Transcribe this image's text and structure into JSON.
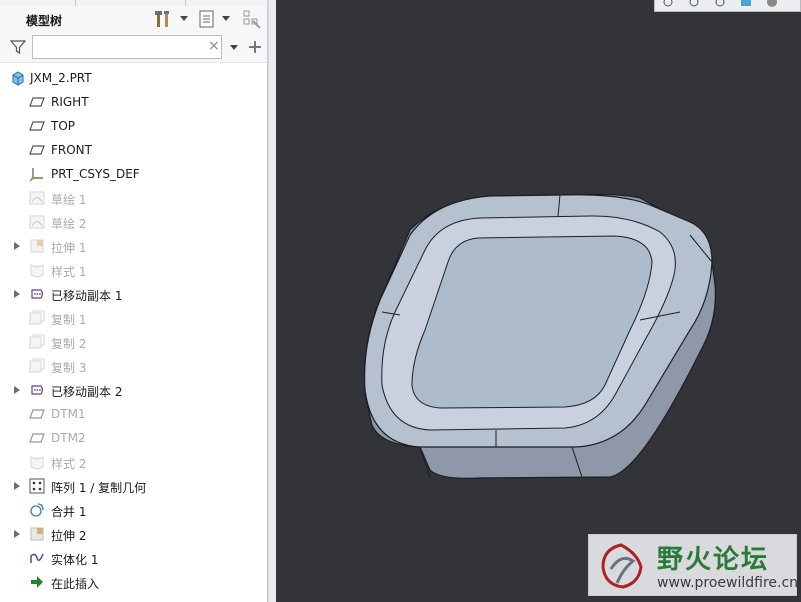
{
  "panel": {
    "title": "模型树",
    "search": {
      "value": "",
      "placeholder": ""
    },
    "clear_glyph": "×"
  },
  "tree": [
    {
      "label": "JXM_2.PRT",
      "icon": "part-icon",
      "root": true,
      "dim": false,
      "expand": false
    },
    {
      "label": "RIGHT",
      "icon": "datum-plane-icon",
      "dim": false,
      "expand": false
    },
    {
      "label": "TOP",
      "icon": "datum-plane-icon",
      "dim": false,
      "expand": false
    },
    {
      "label": "FRONT",
      "icon": "datum-plane-icon",
      "dim": false,
      "expand": false
    },
    {
      "label": "PRT_CSYS_DEF",
      "icon": "coordinate-system-icon",
      "dim": false,
      "expand": false
    },
    {
      "label": "草绘 1",
      "icon": "sketch-icon",
      "dim": true,
      "expand": false
    },
    {
      "label": "草绘 2",
      "icon": "sketch-icon",
      "dim": true,
      "expand": false
    },
    {
      "label": "拉伸 1",
      "icon": "extrude-icon",
      "dim": true,
      "expand": true
    },
    {
      "label": "样式 1",
      "icon": "style-icon",
      "dim": true,
      "expand": false
    },
    {
      "label": "已移动副本 1",
      "icon": "moved-copy-icon",
      "dim": false,
      "expand": true
    },
    {
      "label": "复制 1",
      "icon": "copy-icon",
      "dim": true,
      "expand": false
    },
    {
      "label": "复制 2",
      "icon": "copy-icon",
      "dim": true,
      "expand": false
    },
    {
      "label": "复制 3",
      "icon": "copy-icon",
      "dim": true,
      "expand": false
    },
    {
      "label": "已移动副本 2",
      "icon": "moved-copy-icon",
      "dim": false,
      "expand": true
    },
    {
      "label": "DTM1",
      "icon": "datum-plane-icon",
      "dim": true,
      "expand": false
    },
    {
      "label": "DTM2",
      "icon": "datum-plane-icon",
      "dim": true,
      "expand": false
    },
    {
      "label": "样式 2",
      "icon": "style-icon",
      "dim": true,
      "expand": false
    },
    {
      "label": "阵列 1 / 复制几何",
      "icon": "pattern-icon",
      "dim": false,
      "expand": true
    },
    {
      "label": "合并 1",
      "icon": "merge-icon",
      "dim": false,
      "expand": false
    },
    {
      "label": "拉伸 2",
      "icon": "extrude-icon",
      "dim": false,
      "expand": true
    },
    {
      "label": "实体化 1",
      "icon": "solidify-icon",
      "dim": false,
      "expand": false
    },
    {
      "label": "在此插入",
      "icon": "insert-here-icon",
      "dim": false,
      "expand": false
    }
  ],
  "watermark": {
    "name": "野火论坛",
    "url": "www.proewildfire.cn"
  },
  "colors": {
    "viewport_bg": "#33343a",
    "model_face": "#aebbcb",
    "model_edge": "#1c1e24",
    "dim_text": "#a8abb0"
  }
}
